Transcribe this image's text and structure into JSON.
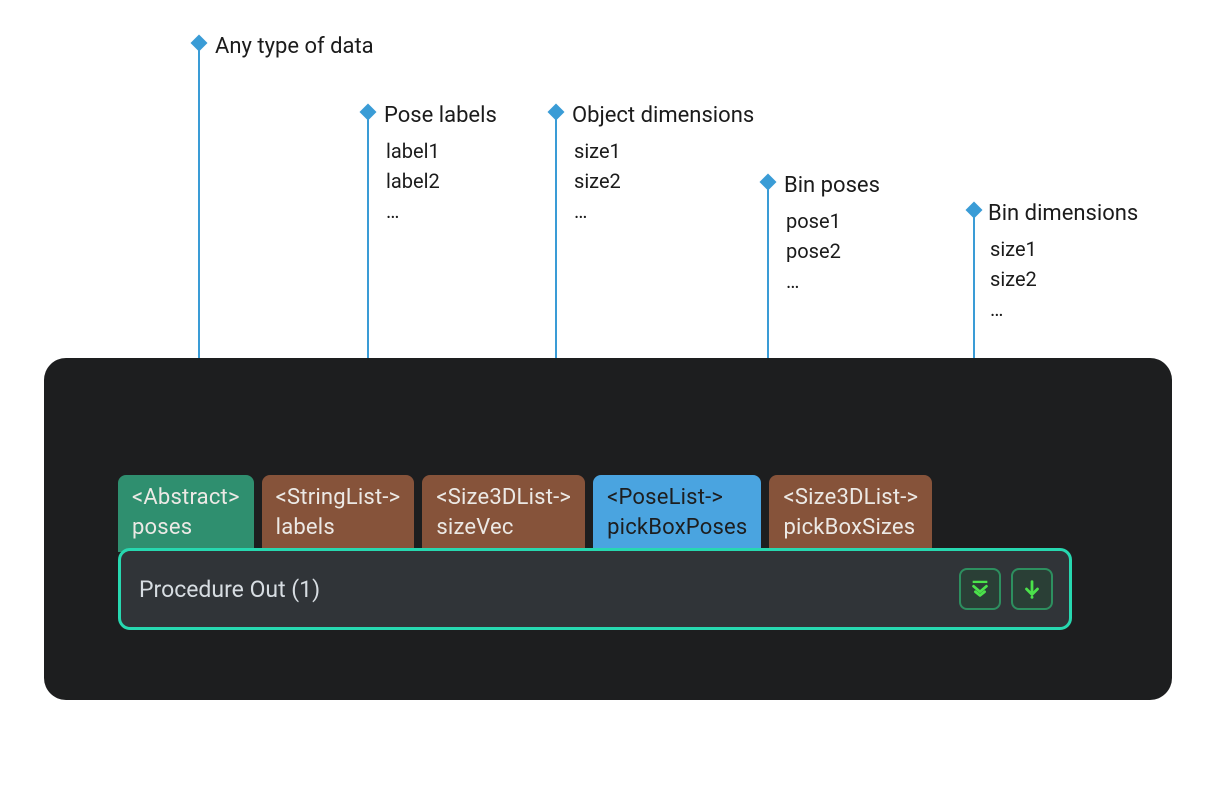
{
  "annotations": {
    "any_data": {
      "title": "Any type of data"
    },
    "pose_labels": {
      "title": "Pose labels",
      "items": [
        "label1",
        "label2",
        "…"
      ]
    },
    "object_dims": {
      "title": "Object dimensions",
      "items": [
        "size1",
        "size2",
        "…"
      ]
    },
    "bin_poses": {
      "title": "Bin poses",
      "items": [
        "pose1",
        "pose2",
        "…"
      ]
    },
    "bin_dims": {
      "title": "Bin dimensions",
      "items": [
        "size1",
        "size2",
        "…"
      ]
    }
  },
  "ports": [
    {
      "type": "<Abstract>",
      "name": "poses",
      "color": "green"
    },
    {
      "type": "<StringList->",
      "name": "labels",
      "color": "brown"
    },
    {
      "type": "<Size3DList->",
      "name": "sizeVec",
      "color": "brown"
    },
    {
      "type": "<PoseList->",
      "name": "pickBoxPoses",
      "color": "blue"
    },
    {
      "type": "<Size3DList->",
      "name": "pickBoxSizes",
      "color": "brown"
    }
  ],
  "node": {
    "title": "Procedure Out (1)"
  },
  "colors": {
    "connector": "#3a9cd6",
    "panel_bg": "#1d1e1f",
    "node_border": "#27d8b0",
    "btn_icon": "#4be24b"
  }
}
